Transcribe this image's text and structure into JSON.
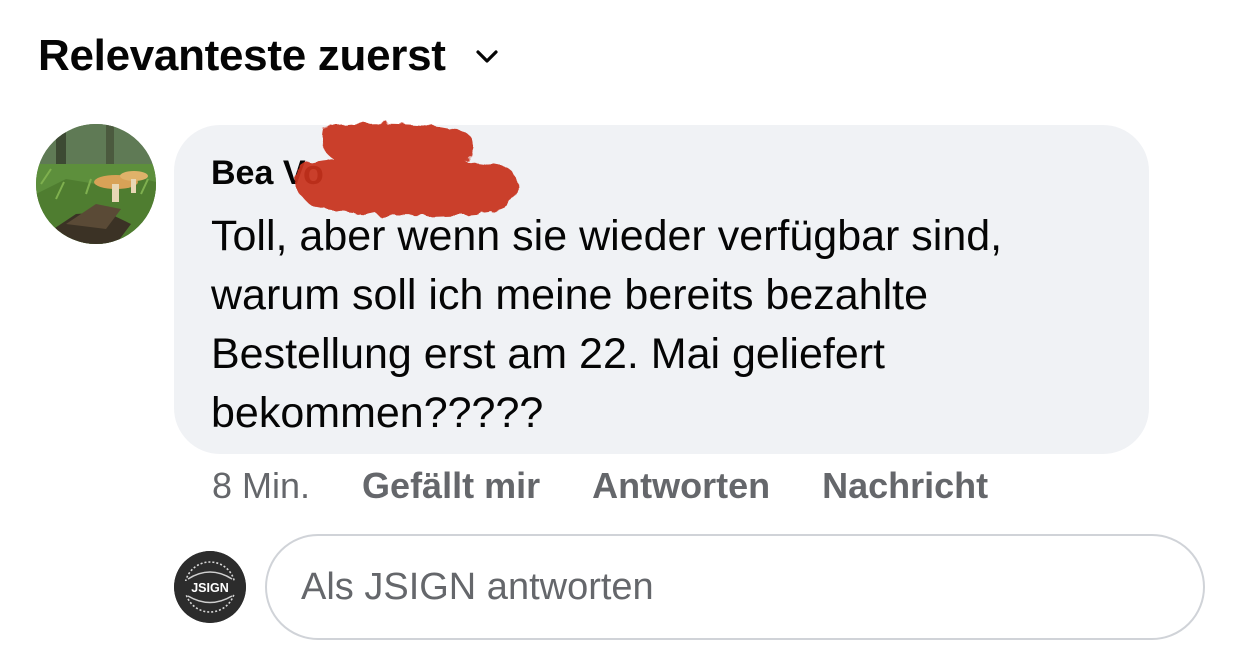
{
  "sort": {
    "label": "Relevanteste zuerst",
    "icon": "chevron-down-icon"
  },
  "comment": {
    "author_visible": "Bea Vo",
    "author_redacted": true,
    "avatar": "mushroom-forest-photo",
    "text": "Toll, aber wenn sie wieder verfügbar sind, warum soll ich meine bereits bezahlte Bestellung erst am 22. Mai geliefert bekommen?????",
    "time": "8 Min.",
    "actions": {
      "like": "Gefällt mir",
      "reply": "Antworten",
      "message": "Nachricht"
    }
  },
  "composer": {
    "avatar_logo_text": "JSIGN",
    "placeholder": "Als JSIGN antworten"
  },
  "colors": {
    "bubble_bg": "#f0f2f5",
    "secondary_text": "#65676b",
    "primary_text": "#050505",
    "redaction": "#c8321f"
  }
}
